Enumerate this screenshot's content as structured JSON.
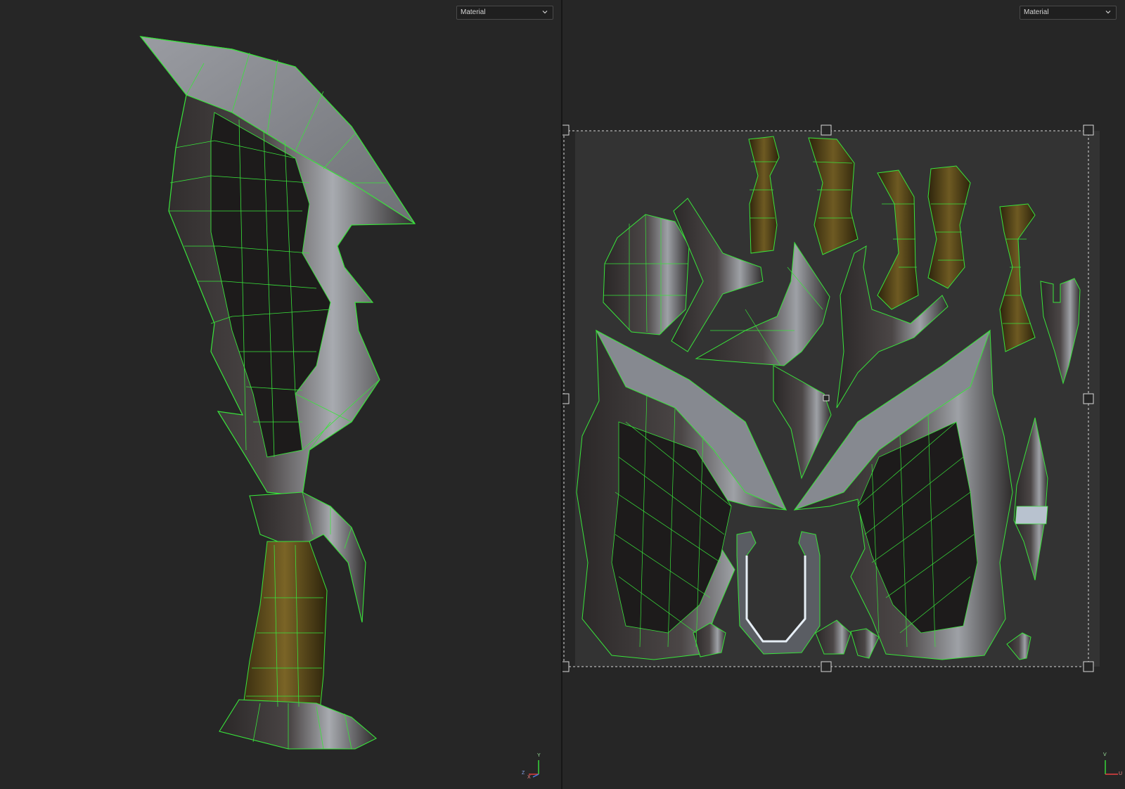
{
  "viewport_3d": {
    "shading_dropdown": {
      "selected": "Material"
    },
    "axis_gizmo": {
      "up": "Y",
      "side": "Z",
      "right": "X"
    }
  },
  "viewport_uv": {
    "shading_dropdown": {
      "selected": "Material"
    },
    "axis_gizmo": {
      "up": "V",
      "right": "U"
    }
  },
  "colors": {
    "background": "#262626",
    "wireframe": "#39e43b",
    "uv_tile": "#333333",
    "selection_box": "#d8d8d8",
    "metal": "#3e3a3a",
    "blade_edge": "#8c8f95",
    "handle_wood": "#5a4a1c"
  }
}
